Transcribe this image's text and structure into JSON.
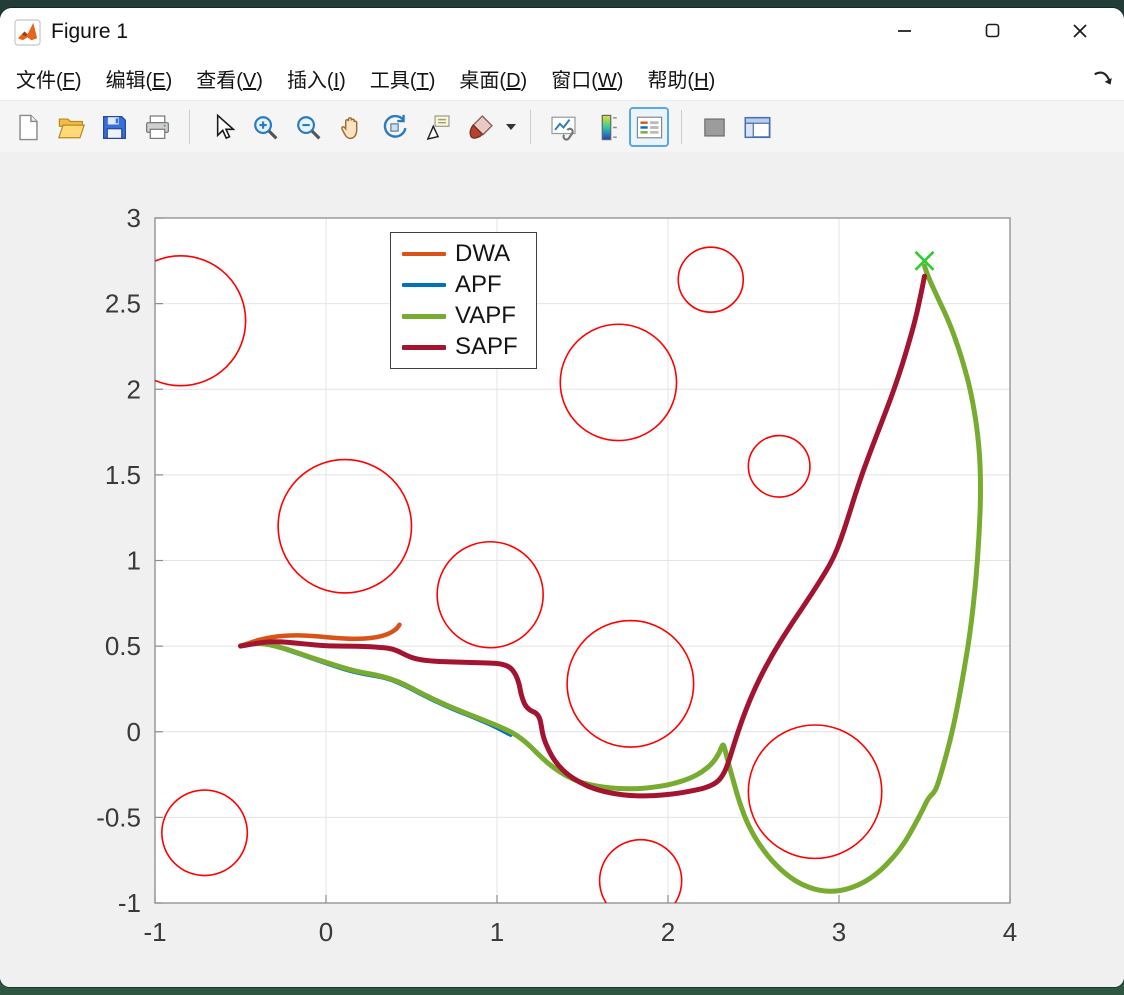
{
  "window": {
    "title": "Figure 1",
    "controls": [
      {
        "name": "minimize"
      },
      {
        "name": "maximize"
      },
      {
        "name": "close"
      }
    ]
  },
  "menu": {
    "items": [
      {
        "id": "file",
        "label": "文件(F)"
      },
      {
        "id": "edit",
        "label": "编辑(E)"
      },
      {
        "id": "view",
        "label": "查看(V)"
      },
      {
        "id": "insert",
        "label": "插入(I)"
      },
      {
        "id": "tools",
        "label": "工具(T)"
      },
      {
        "id": "desktop",
        "label": "桌面(D)"
      },
      {
        "id": "window",
        "label": "窗口(W)"
      },
      {
        "id": "help",
        "label": "帮助(H)"
      }
    ]
  },
  "toolbar": {
    "buttons": [
      {
        "name": "new-figure",
        "icon": "new-document"
      },
      {
        "name": "open-file",
        "icon": "open-folder"
      },
      {
        "name": "save-figure",
        "icon": "save-floppy"
      },
      {
        "name": "print-figure",
        "icon": "printer"
      },
      {
        "type": "separator"
      },
      {
        "name": "edit-plot",
        "icon": "cursor-arrow"
      },
      {
        "name": "zoom-in",
        "icon": "zoom-in"
      },
      {
        "name": "zoom-out",
        "icon": "zoom-out"
      },
      {
        "name": "pan",
        "icon": "pan-hand"
      },
      {
        "name": "rotate-3d",
        "icon": "rotate-3d"
      },
      {
        "name": "data-cursor",
        "icon": "data-cursor"
      },
      {
        "name": "brush-data",
        "icon": "brush",
        "dropdown": true
      },
      {
        "type": "separator"
      },
      {
        "name": "link-plot",
        "icon": "link-plot"
      },
      {
        "name": "insert-colorbar",
        "icon": "colorbar"
      },
      {
        "name": "insert-legend",
        "icon": "legend",
        "selected": true
      },
      {
        "type": "separator"
      },
      {
        "name": "hide-plot-tools",
        "icon": "hide-plot-tools"
      },
      {
        "name": "show-plot-tools",
        "icon": "show-plot-tools"
      }
    ]
  },
  "chart_data": {
    "type": "line",
    "title": "",
    "xlabel": "",
    "ylabel": "",
    "xlim": [
      -1,
      4
    ],
    "ylim": [
      -1,
      3
    ],
    "xticks": [
      -1,
      0,
      1,
      2,
      3,
      4
    ],
    "yticks": [
      -1,
      -0.5,
      0,
      0.5,
      1,
      1.5,
      2,
      2.5,
      3
    ],
    "grid": true,
    "style": {
      "plot_bg": "#ffffff",
      "axis_color": "#8c8c8c",
      "grid_color": "#e4e4e4",
      "tick_color": "#3a3a3a"
    },
    "legend": {
      "visible": true,
      "position": "upper-left-inside",
      "entries": [
        "DWA",
        "APF",
        "VAPF",
        "SAPF"
      ]
    },
    "start_point": [
      -0.5,
      0.5
    ],
    "goal": {
      "x": 3.5,
      "y": 2.75,
      "marker": "x",
      "color": "#2ecc2e"
    },
    "obstacles": {
      "color": "#ff0000",
      "circles": [
        {
          "x": -0.85,
          "y": 2.4,
          "r": 0.38
        },
        {
          "x": 2.25,
          "y": 2.64,
          "r": 0.19
        },
        {
          "x": 1.71,
          "y": 2.04,
          "r": 0.34
        },
        {
          "x": 2.65,
          "y": 1.55,
          "r": 0.18
        },
        {
          "x": 0.11,
          "y": 1.2,
          "r": 0.39
        },
        {
          "x": 0.96,
          "y": 0.8,
          "r": 0.31
        },
        {
          "x": 1.78,
          "y": 0.28,
          "r": 0.37
        },
        {
          "x": 2.86,
          "y": -0.35,
          "r": 0.39
        },
        {
          "x": -0.71,
          "y": -0.59,
          "r": 0.25
        },
        {
          "x": 1.84,
          "y": -0.87,
          "r": 0.24
        }
      ]
    },
    "series": [
      {
        "name": "DWA",
        "color": "#D95319",
        "width": 4.5,
        "points": [
          [
            -0.5,
            0.5
          ],
          [
            -0.43,
            0.525
          ],
          [
            -0.36,
            0.545
          ],
          [
            -0.28,
            0.558
          ],
          [
            -0.2,
            0.563
          ],
          [
            -0.12,
            0.562
          ],
          [
            -0.04,
            0.556
          ],
          [
            0.05,
            0.548
          ],
          [
            0.14,
            0.542
          ],
          [
            0.22,
            0.543
          ],
          [
            0.3,
            0.552
          ],
          [
            0.36,
            0.568
          ],
          [
            0.41,
            0.597
          ],
          [
            0.43,
            0.625
          ]
        ]
      },
      {
        "name": "APF",
        "color": "#0072BD",
        "width": 3.5,
        "points": [
          [
            -0.5,
            0.5
          ],
          [
            -0.42,
            0.513
          ],
          [
            -0.34,
            0.508
          ],
          [
            -0.26,
            0.487
          ],
          [
            -0.18,
            0.46
          ],
          [
            -0.1,
            0.432
          ],
          [
            -0.02,
            0.405
          ],
          [
            0.06,
            0.378
          ],
          [
            0.14,
            0.353
          ],
          [
            0.22,
            0.335
          ],
          [
            0.3,
            0.322
          ],
          [
            0.38,
            0.303
          ],
          [
            0.46,
            0.268
          ],
          [
            0.54,
            0.225
          ],
          [
            0.62,
            0.185
          ],
          [
            0.7,
            0.148
          ],
          [
            0.78,
            0.115
          ],
          [
            0.86,
            0.083
          ],
          [
            0.94,
            0.05
          ],
          [
            1.0,
            0.022
          ],
          [
            1.05,
            -0.005
          ],
          [
            1.08,
            -0.02
          ]
        ]
      },
      {
        "name": "VAPF",
        "color": "#77AC30",
        "width": 5,
        "points": [
          [
            -0.5,
            0.502
          ],
          [
            -0.42,
            0.518
          ],
          [
            -0.34,
            0.512
          ],
          [
            -0.26,
            0.492
          ],
          [
            -0.18,
            0.466
          ],
          [
            -0.1,
            0.438
          ],
          [
            -0.02,
            0.412
          ],
          [
            0.06,
            0.386
          ],
          [
            0.14,
            0.362
          ],
          [
            0.22,
            0.344
          ],
          [
            0.3,
            0.33
          ],
          [
            0.38,
            0.31
          ],
          [
            0.46,
            0.276
          ],
          [
            0.54,
            0.234
          ],
          [
            0.62,
            0.194
          ],
          [
            0.7,
            0.157
          ],
          [
            0.78,
            0.124
          ],
          [
            0.86,
            0.092
          ],
          [
            0.94,
            0.06
          ],
          [
            1.02,
            0.028
          ],
          [
            1.09,
            -0.005
          ],
          [
            1.15,
            -0.045
          ],
          [
            1.2,
            -0.09
          ],
          [
            1.26,
            -0.15
          ],
          [
            1.33,
            -0.21
          ],
          [
            1.41,
            -0.262
          ],
          [
            1.5,
            -0.3
          ],
          [
            1.6,
            -0.322
          ],
          [
            1.71,
            -0.333
          ],
          [
            1.83,
            -0.333
          ],
          [
            1.94,
            -0.322
          ],
          [
            2.04,
            -0.302
          ],
          [
            2.13,
            -0.272
          ],
          [
            2.2,
            -0.235
          ],
          [
            2.26,
            -0.185
          ],
          [
            2.3,
            -0.125
          ],
          [
            2.32,
            -0.07
          ],
          [
            2.33,
            -0.09
          ],
          [
            2.35,
            -0.17
          ],
          [
            2.38,
            -0.28
          ],
          [
            2.42,
            -0.42
          ],
          [
            2.47,
            -0.55
          ],
          [
            2.54,
            -0.67
          ],
          [
            2.63,
            -0.78
          ],
          [
            2.74,
            -0.872
          ],
          [
            2.86,
            -0.925
          ],
          [
            2.98,
            -0.935
          ],
          [
            3.1,
            -0.905
          ],
          [
            3.21,
            -0.84
          ],
          [
            3.3,
            -0.755
          ],
          [
            3.38,
            -0.655
          ],
          [
            3.44,
            -0.55
          ],
          [
            3.49,
            -0.455
          ],
          [
            3.52,
            -0.39
          ],
          [
            3.56,
            -0.35
          ],
          [
            3.58,
            -0.3
          ],
          [
            3.61,
            -0.2
          ],
          [
            3.65,
            -0.05
          ],
          [
            3.69,
            0.13
          ],
          [
            3.73,
            0.35
          ],
          [
            3.77,
            0.6
          ],
          [
            3.8,
            0.87
          ],
          [
            3.82,
            1.15
          ],
          [
            3.83,
            1.42
          ],
          [
            3.82,
            1.68
          ],
          [
            3.78,
            1.95
          ],
          [
            3.72,
            2.18
          ],
          [
            3.65,
            2.38
          ],
          [
            3.57,
            2.55
          ],
          [
            3.52,
            2.66
          ],
          [
            3.5,
            2.72
          ]
        ]
      },
      {
        "name": "SAPF",
        "color": "#A2142F",
        "width": 5,
        "points": [
          [
            -0.5,
            0.5
          ],
          [
            -0.42,
            0.515
          ],
          [
            -0.34,
            0.525
          ],
          [
            -0.26,
            0.525
          ],
          [
            -0.18,
            0.518
          ],
          [
            -0.1,
            0.51
          ],
          [
            -0.02,
            0.503
          ],
          [
            0.06,
            0.5
          ],
          [
            0.14,
            0.5
          ],
          [
            0.22,
            0.498
          ],
          [
            0.3,
            0.494
          ],
          [
            0.38,
            0.486
          ],
          [
            0.43,
            0.468
          ],
          [
            0.47,
            0.445
          ],
          [
            0.52,
            0.427
          ],
          [
            0.58,
            0.416
          ],
          [
            0.66,
            0.41
          ],
          [
            0.75,
            0.407
          ],
          [
            0.85,
            0.404
          ],
          [
            0.95,
            0.402
          ],
          [
            1.03,
            0.396
          ],
          [
            1.08,
            0.375
          ],
          [
            1.11,
            0.335
          ],
          [
            1.13,
            0.28
          ],
          [
            1.14,
            0.22
          ],
          [
            1.16,
            0.16
          ],
          [
            1.19,
            0.125
          ],
          [
            1.23,
            0.11
          ],
          [
            1.25,
            0.08
          ],
          [
            1.26,
            0.03
          ],
          [
            1.27,
            -0.03
          ],
          [
            1.3,
            -0.105
          ],
          [
            1.34,
            -0.175
          ],
          [
            1.4,
            -0.24
          ],
          [
            1.48,
            -0.295
          ],
          [
            1.57,
            -0.335
          ],
          [
            1.68,
            -0.362
          ],
          [
            1.8,
            -0.375
          ],
          [
            1.92,
            -0.374
          ],
          [
            2.03,
            -0.364
          ],
          [
            2.13,
            -0.348
          ],
          [
            2.22,
            -0.328
          ],
          [
            2.29,
            -0.295
          ],
          [
            2.33,
            -0.24
          ],
          [
            2.36,
            -0.16
          ],
          [
            2.39,
            -0.06
          ],
          [
            2.43,
            0.06
          ],
          [
            2.48,
            0.19
          ],
          [
            2.54,
            0.32
          ],
          [
            2.61,
            0.45
          ],
          [
            2.69,
            0.58
          ],
          [
            2.77,
            0.7
          ],
          [
            2.85,
            0.82
          ],
          [
            2.92,
            0.93
          ],
          [
            2.97,
            1.02
          ],
          [
            3.01,
            1.12
          ],
          [
            3.05,
            1.24
          ],
          [
            3.09,
            1.37
          ],
          [
            3.14,
            1.52
          ],
          [
            3.2,
            1.68
          ],
          [
            3.27,
            1.86
          ],
          [
            3.34,
            2.05
          ],
          [
            3.4,
            2.24
          ],
          [
            3.45,
            2.42
          ],
          [
            3.48,
            2.56
          ],
          [
            3.5,
            2.66
          ]
        ]
      }
    ]
  }
}
